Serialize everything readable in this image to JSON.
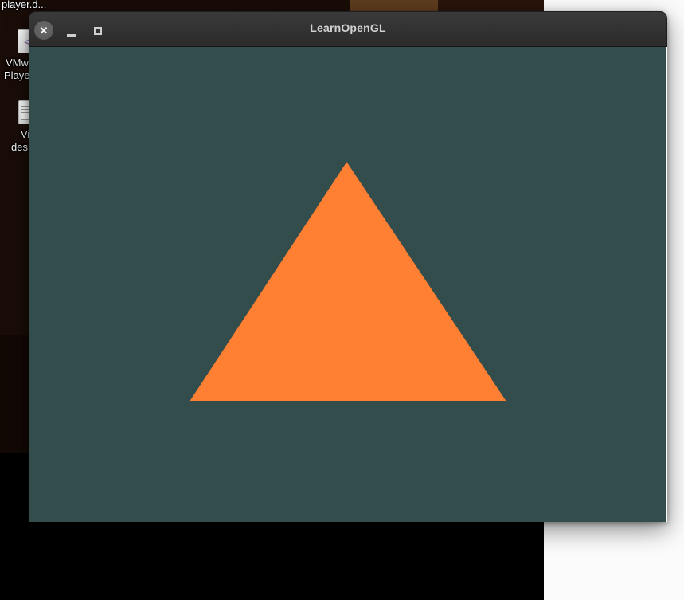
{
  "desktop": {
    "colors": {
      "wallpaper_base": "#1a0d08",
      "wallpaper_patch_light": "#5e3c1e",
      "wallpaper_patch_mid": "#2a140b",
      "wallpaper_patch_dark": "#120905",
      "black_panel": "#000000",
      "white_window": "#fbfbfb"
    },
    "top_partial_label": "player.d...",
    "icons": [
      {
        "name": "vmware-player-file",
        "glyph": "<",
        "glyph_color": "#8e7bb8",
        "label_line1": "VMw",
        "label_line2": "Playe"
      },
      {
        "name": "text-document-file",
        "label_line1": "Vi",
        "label_line2": "des"
      }
    ]
  },
  "window": {
    "title": "LearnOpenGL",
    "colors": {
      "titlebar_text": "#d2d2d2",
      "close_button_bg": "#606060",
      "control_glyph": "#cfcfcf"
    },
    "controls": {
      "close_glyph": "✕"
    },
    "content": {
      "background": "#334d4d",
      "triangle_color": "#ff8033",
      "triangle_clip": "polygon(49.8% 24.2%, 25.2% 74.5%, 74.8% 74.5%)"
    }
  }
}
